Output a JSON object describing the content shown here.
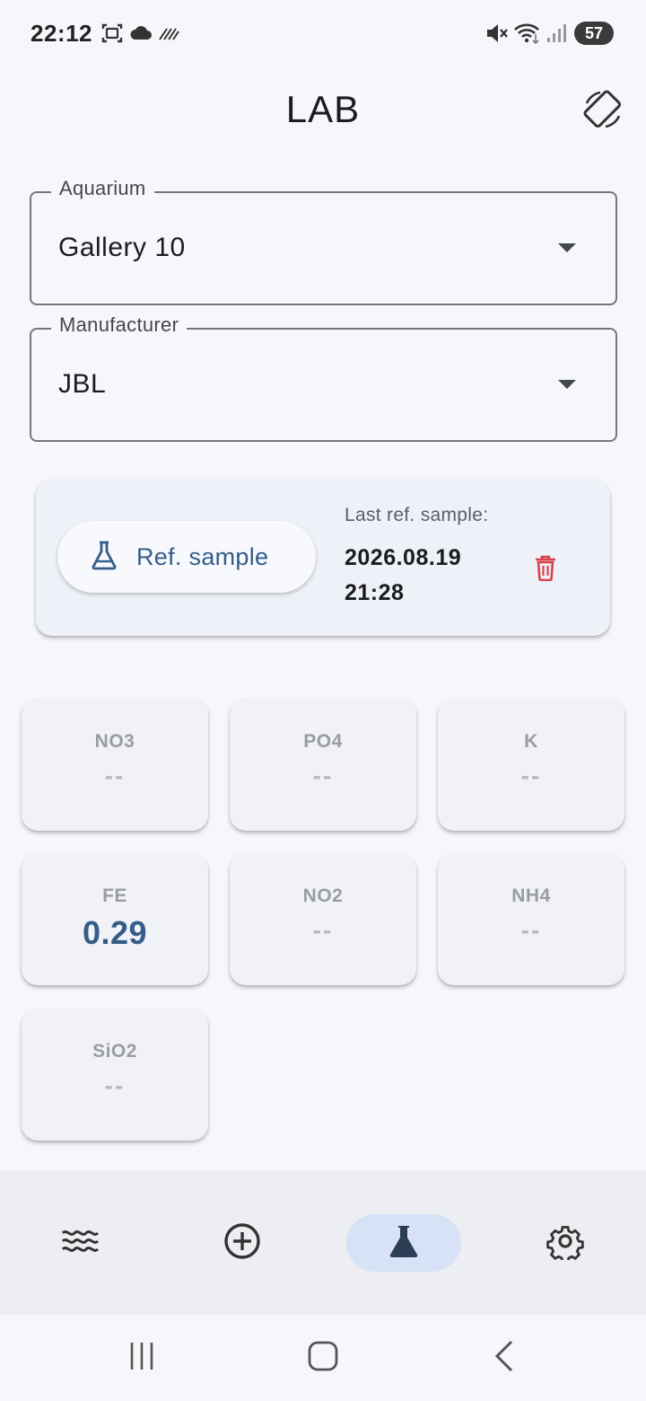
{
  "status_bar": {
    "time": "22:12",
    "battery": "57",
    "icons": [
      "screenshot-icon",
      "cloud-icon",
      "stripes-icon",
      "mute-icon",
      "wifi-icon",
      "signal-icon"
    ]
  },
  "header": {
    "title": "LAB",
    "rotate_icon": "screen-rotation-icon"
  },
  "aquarium_field": {
    "label": "Aquarium",
    "value": "Gallery 10"
  },
  "manufacturer_field": {
    "label": "Manufacturer",
    "value": "JBL"
  },
  "reference": {
    "button_label": "Ref. sample",
    "button_icon": "flask-icon",
    "last_label": "Last ref. sample:",
    "last_date": "2026.08.19",
    "last_time": "21:28",
    "delete_icon": "trash-icon",
    "delete_color": "#d8434a"
  },
  "parameters": [
    {
      "name": "NO3",
      "value": "--",
      "active": false
    },
    {
      "name": "PO4",
      "value": "--",
      "active": false
    },
    {
      "name": "K",
      "value": "--",
      "active": false
    },
    {
      "name": "FE",
      "value": "0.29",
      "active": true
    },
    {
      "name": "NO2",
      "value": "--",
      "active": false
    },
    {
      "name": "NH4",
      "value": "--",
      "active": false
    },
    {
      "name": "SiO2",
      "value": "--",
      "active": false
    }
  ],
  "bottom_nav": [
    {
      "icon": "waves-icon",
      "active": false
    },
    {
      "icon": "add-circle-icon",
      "active": false
    },
    {
      "icon": "flask-icon",
      "active": true
    },
    {
      "icon": "gear-icon",
      "active": false
    }
  ],
  "colors": {
    "accent": "#355d89",
    "background": "#f6f7fb",
    "nav_active": "#d8e2f6"
  }
}
